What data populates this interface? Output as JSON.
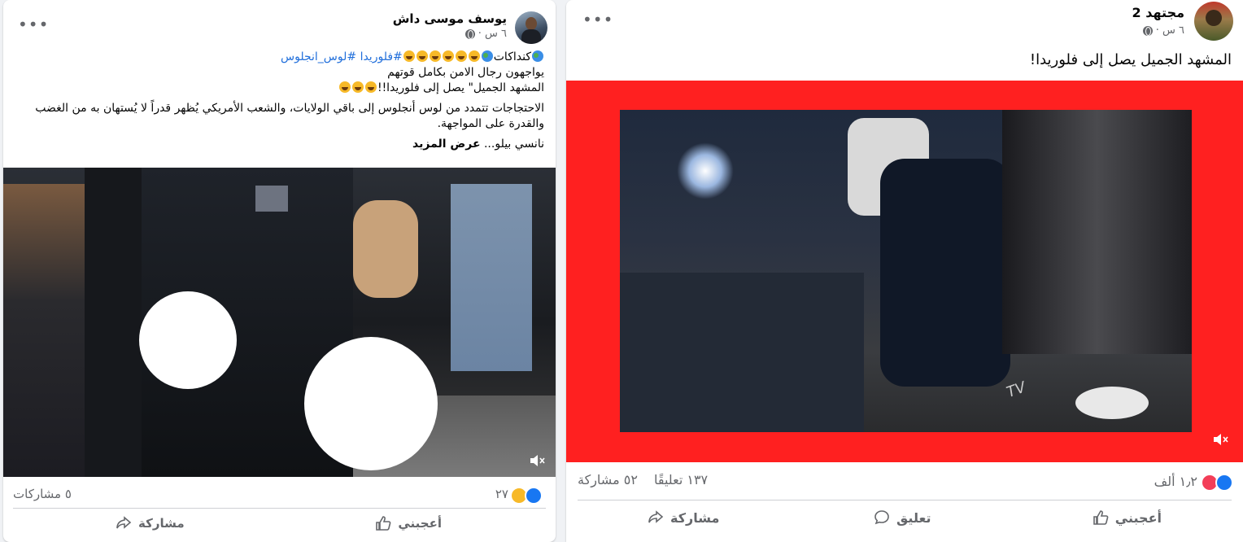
{
  "left_post": {
    "author": "يوسف موسى داش",
    "time": "٦ س ·",
    "line1_prefix": "كنداكات",
    "line1_hashtags": "#فلوريدا #لوس_انجلوس",
    "line2": "يواجهون رجال الامن بكامل قوتهم",
    "line3": "المشهد الجميل\" يصل إلى فلوريدا!!",
    "paragraph": "الاحتجاجات تتمدد من لوس أنجلوس إلى باقي الولايات، والشعب الأمريكي يُظهر قدراً لا يُستهان به من الغضب والقدرة على المواجهة.",
    "tail_text": "نانسي بيلو...",
    "see_more": "عرض المزيد",
    "reaction_count": "٢٧",
    "shares": "٥ مشاركات",
    "like_label": "أعجبني",
    "share_label": "مشاركة"
  },
  "right_post": {
    "author": "مجتهد 2",
    "time": "٦ س ·",
    "caption": "المشهد الجميل يصل إلى فلوريدا!",
    "reaction_count": "١٫٢ ألف",
    "comments": "١٣٧ تعليقًا",
    "shares": "٥٢ مشاركة",
    "like_label": "أعجبني",
    "comment_label": "تعليق",
    "share_label": "مشاركة",
    "watermark": "TV"
  },
  "colors": {
    "accent": "#1877f2",
    "hashtag": "#216fdb",
    "video_frame": "#ff2020",
    "muted_text": "#65676b"
  }
}
